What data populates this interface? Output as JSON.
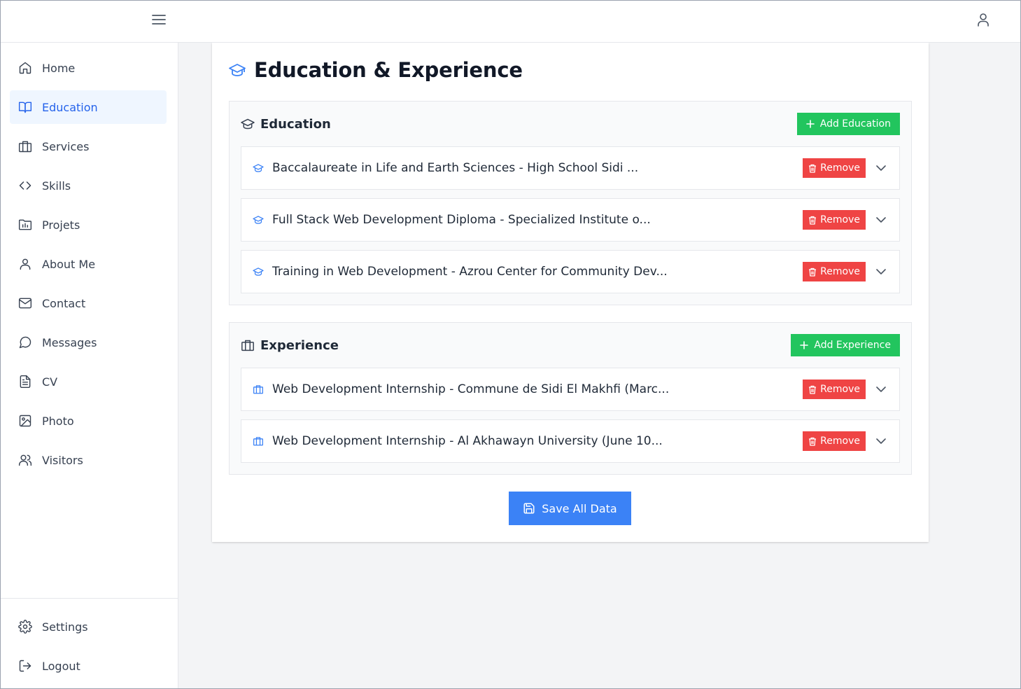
{
  "header": {
    "menu_icon": "hamburger-icon",
    "user_icon": "user-icon"
  },
  "sidebar": {
    "items": [
      {
        "label": "Home",
        "icon": "home-icon"
      },
      {
        "label": "Education",
        "icon": "book-open-icon",
        "active": true
      },
      {
        "label": "Services",
        "icon": "briefcase-icon"
      },
      {
        "label": "Skills",
        "icon": "code-icon"
      },
      {
        "label": "Projets",
        "icon": "folder-chart-icon"
      },
      {
        "label": "About Me",
        "icon": "user-icon"
      },
      {
        "label": "Contact",
        "icon": "mail-icon"
      },
      {
        "label": "Messages",
        "icon": "message-circle-icon"
      },
      {
        "label": "CV",
        "icon": "file-text-icon"
      },
      {
        "label": "Photo",
        "icon": "image-icon"
      },
      {
        "label": "Visitors",
        "icon": "users-icon"
      }
    ],
    "bottom": [
      {
        "label": "Settings",
        "icon": "gear-icon"
      },
      {
        "label": "Logout",
        "icon": "logout-icon"
      }
    ]
  },
  "main": {
    "title": "Education & Experience",
    "education": {
      "title": "Education",
      "add_label": "Add Education",
      "entries": [
        {
          "title": "Baccalaureate in Life and Earth Sciences - High School Sidi ..."
        },
        {
          "title": "Full Stack Web Development Diploma - Specialized Institute o..."
        },
        {
          "title": "Training in Web Development - Azrou Center for Community Dev..."
        }
      ]
    },
    "experience": {
      "title": "Experience",
      "add_label": "Add Experience",
      "entries": [
        {
          "title": "Web Development Internship - Commune de Sidi El Makhfi (Marc..."
        },
        {
          "title": "Web Development Internship - Al Akhawayn University (June 10..."
        }
      ]
    },
    "remove_label": "Remove",
    "save_label": "Save All Data"
  },
  "colors": {
    "accent": "#3b82f6",
    "success": "#22c55e",
    "danger": "#ef4444",
    "active_bg": "#eff6ff"
  }
}
